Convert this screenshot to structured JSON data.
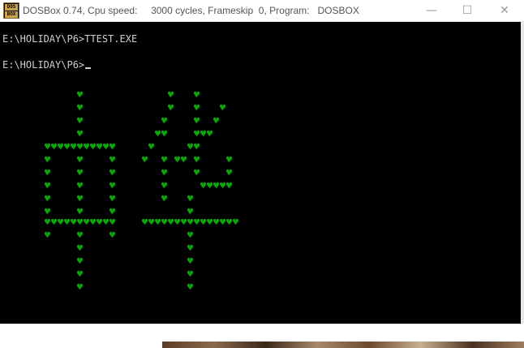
{
  "window": {
    "title": "DOSBox 0.74, Cpu speed:     3000 cycles, Frameskip  0, Program:   DOSBOX",
    "icon_label_top": "DOS",
    "icon_label_bottom": "BOX",
    "controls": {
      "minimize": "—",
      "maximize": "☐",
      "close": "✕"
    }
  },
  "console": {
    "lines": [
      "E:\\HOLIDAY\\P6>TTEST.EXE",
      "E:\\HOLIDAY\\P6>"
    ],
    "heart_glyph": "♥",
    "heart_color": "#00aa00",
    "text_color": "#cfcfcf"
  }
}
